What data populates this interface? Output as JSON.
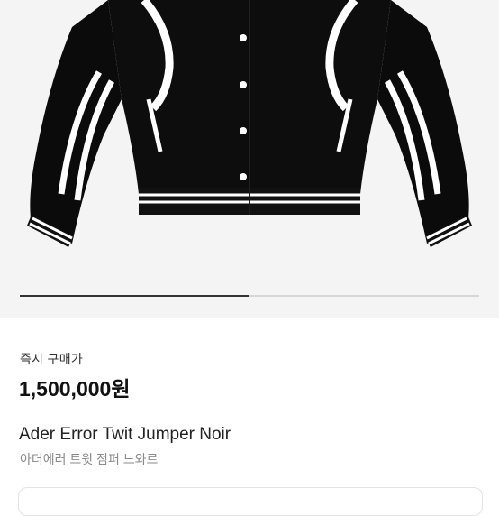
{
  "product_image": {
    "alt": "Ader Error Twit Jumper Noir",
    "icon": "varsity-jacket-image"
  },
  "carousel": {
    "progress": 0.5
  },
  "price_label": "즉시 구매가",
  "price": "1,500,000원",
  "product_name_en": "Ader Error Twit Jumper Noir",
  "product_name_ko": "아더에러 트윗 점퍼 느와르",
  "colors": {
    "hero_bg": "#f4f4f4",
    "text": "#111111",
    "muted": "#8a8a8a",
    "progress": "#333333"
  }
}
